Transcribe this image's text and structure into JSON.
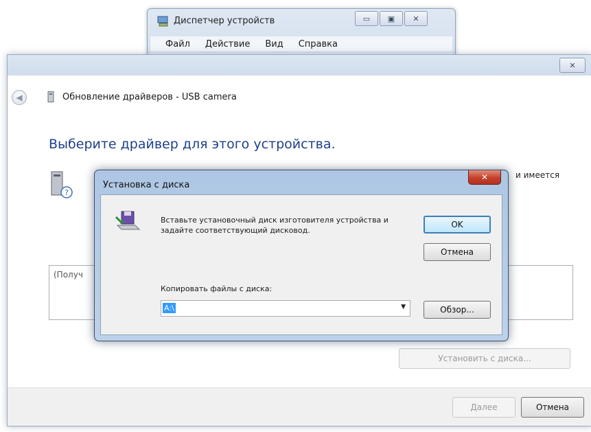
{
  "device_manager": {
    "title": "Диспетчер устройств",
    "menu": [
      "Файл",
      "Действие",
      "Вид",
      "Справка"
    ],
    "window_buttons": {
      "minimize": "▭",
      "maximize": "▣",
      "close": "✕"
    }
  },
  "wizard": {
    "close": "✕",
    "back": "◀",
    "header_title": "Обновление драйверов - USB camera",
    "headline": "Выберите драйвер для этого устройства.",
    "description_fragment": "и имеется",
    "list_text": "(Получ",
    "have_disk_button": "Установить с диска...",
    "next_button": "Далее",
    "cancel_button": "Отмена"
  },
  "install_from_disk": {
    "title": "Установка с диска",
    "close": "✕",
    "instruction": "Вставьте установочный диск изготовителя устройства и задайте соответствующий дисковод.",
    "ok_button": "OK",
    "cancel_button": "Отмена",
    "copy_label": "Копировать файлы с диска:",
    "path_value": "A:\\",
    "browse_button": "Обзор..."
  }
}
